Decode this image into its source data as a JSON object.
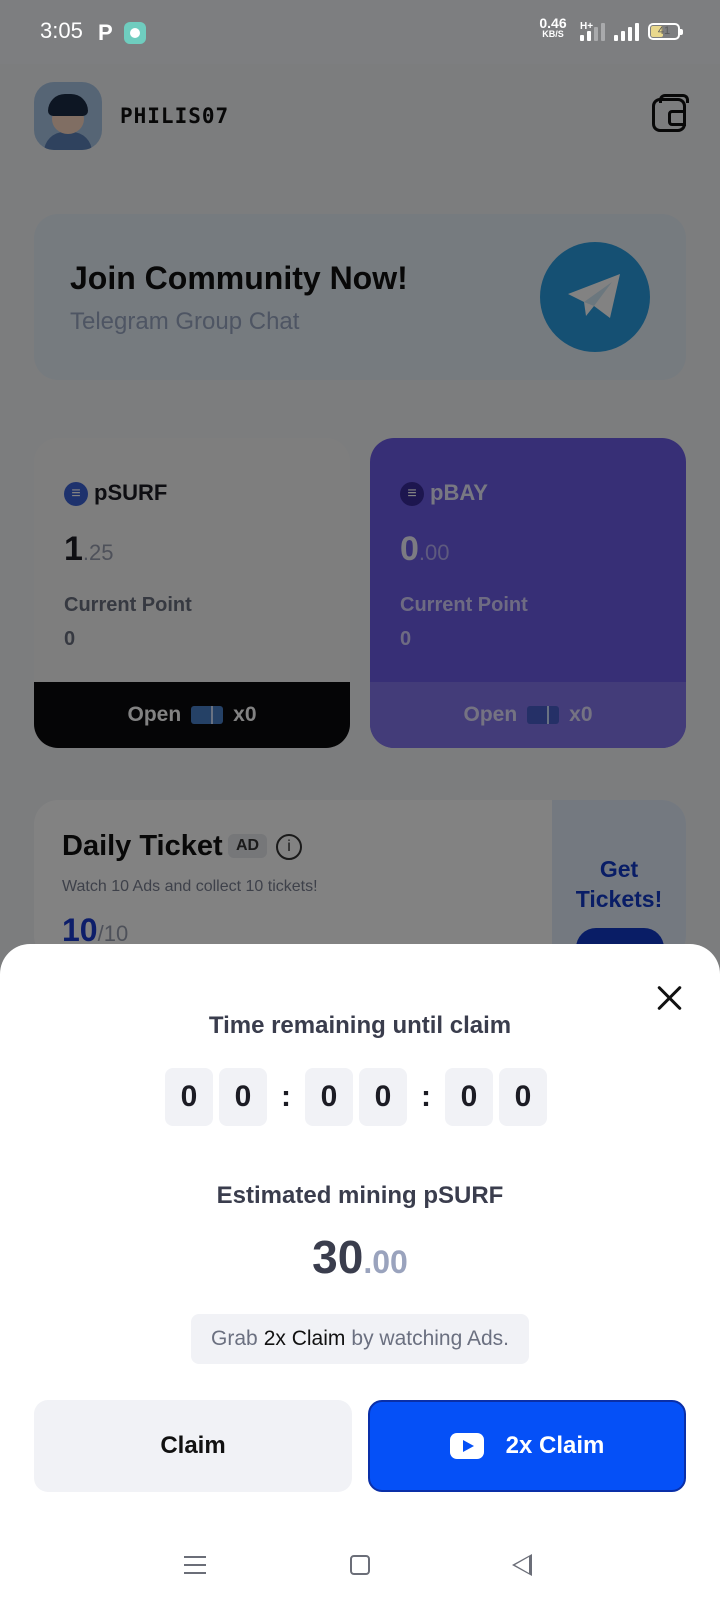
{
  "status_bar": {
    "time": "3:05",
    "p_glyph": "P",
    "speed_value": "0.46",
    "speed_unit": "KB/S",
    "network_type": "H+",
    "battery_level": "41"
  },
  "header": {
    "username": "PHILIS07"
  },
  "community": {
    "title": "Join Community Now!",
    "subtitle": "Telegram Group Chat"
  },
  "cards": [
    {
      "token": "pSURF",
      "amount_int": "1",
      "amount_dec": ".25",
      "current_point_label": "Current Point",
      "current_point_value": "0",
      "open_label": "Open",
      "open_count": "x0"
    },
    {
      "token": "pBAY",
      "amount_int": "0",
      "amount_dec": ".00",
      "current_point_label": "Current Point",
      "current_point_value": "0",
      "open_label": "Open",
      "open_count": "x0"
    }
  ],
  "daily_ticket": {
    "title": "Daily Ticket",
    "ad_badge": "AD",
    "info_glyph": "i",
    "description": "Watch 10 Ads and collect 10 tickets!",
    "count": "10",
    "total": "/10",
    "get_tickets_line1": "Get",
    "get_tickets_line2": "Tickets!"
  },
  "claim_sheet": {
    "timer_label": "Time remaining until claim",
    "timer_digits": [
      "0",
      "0",
      "0",
      "0",
      "0",
      "0"
    ],
    "separator": ":",
    "estimate_label": "Estimated mining pSURF",
    "estimate_int": "30",
    "estimate_dec": ".00",
    "grab_prefix": "Grab",
    "grab_highlight": "2x Claim",
    "grab_suffix": "by watching Ads.",
    "claim_button": "Claim",
    "double_claim_button": "2x Claim"
  },
  "colors": {
    "accent_blue": "#0550f7",
    "pbay_purple": "#6c5ce7",
    "telegram_blue": "#2a9ee1"
  },
  "icons": [
    "wallet-icon",
    "telegram-icon",
    "ticket-icon",
    "info-icon",
    "close-icon",
    "youtube-icon",
    "menu-icon",
    "home-icon",
    "back-icon"
  ]
}
